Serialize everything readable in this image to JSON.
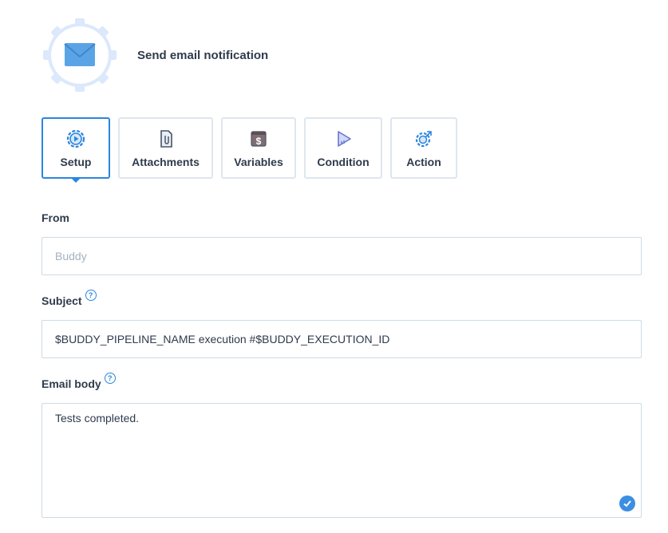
{
  "header": {
    "title": "Send email notification",
    "icon": "envelope-icon",
    "gear_color": "#dce8fb",
    "envelope_color": "#5aa4e6"
  },
  "tabs": [
    {
      "label": "Setup",
      "icon": "setup-play-gear-icon",
      "active": true
    },
    {
      "label": "Attachments",
      "icon": "attachment-file-icon",
      "active": false
    },
    {
      "label": "Variables",
      "icon": "dollar-icon",
      "active": false
    },
    {
      "label": "Condition",
      "icon": "condition-play-icon",
      "active": false
    },
    {
      "label": "Action",
      "icon": "action-gear-icon",
      "active": false
    }
  ],
  "form": {
    "from": {
      "label": "From",
      "placeholder": "Buddy",
      "value": ""
    },
    "subject": {
      "label": "Subject",
      "help": "?",
      "value": "$BUDDY_PIPELINE_NAME execution #$BUDDY_EXECUTION_ID"
    },
    "email_body": {
      "label": "Email body",
      "help": "?",
      "value": "Tests completed."
    }
  },
  "colors": {
    "accent": "#2a85e0",
    "border": "#cddbe4",
    "tab_border": "#dfe6ee",
    "text": "#2f3b4c",
    "placeholder": "#a4b1be"
  }
}
